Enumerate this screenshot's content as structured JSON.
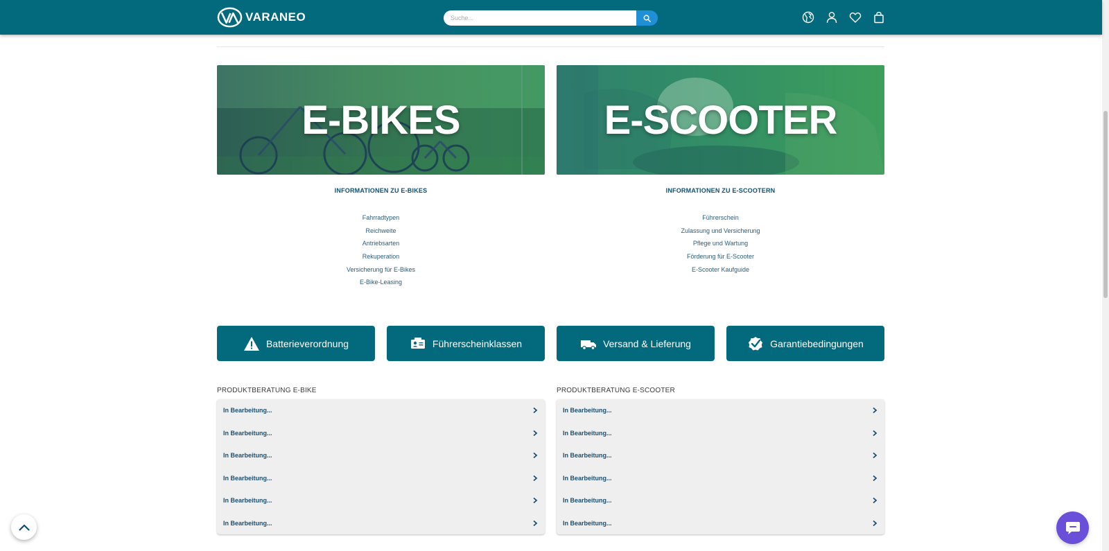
{
  "header": {
    "brand": "VARANEO",
    "search": {
      "placeholder": "Suche..."
    },
    "icons": [
      "globe-icon",
      "user-icon",
      "heart-icon",
      "shopping-bag-icon"
    ],
    "background_color": "#036a7e"
  },
  "banners": [
    {
      "title": "E-BIKES"
    },
    {
      "title": "E-SCOOTER"
    }
  ],
  "info": {
    "ebikes": {
      "heading": "INFORMATIONEN ZU E-BIKES",
      "links": [
        "Fahrradtypen",
        "Reichweite",
        "Antriebsarten",
        "Rekuperation",
        "Versicherung für E-Bikes",
        "E-Bike-Leasing"
      ]
    },
    "escooter": {
      "heading": "INFORMATIONEN ZU E-SCOOTERN",
      "links": [
        "Führerschein",
        "Zulassung und Versicherung",
        "Pflege und Wartung",
        "Förderung für E-Scooter",
        "E-Scooter Kaufguide"
      ]
    }
  },
  "buttons": [
    {
      "label": "Batterieverordnung",
      "icon": "warning-icon"
    },
    {
      "label": "Führerscheinklassen",
      "icon": "id-card-icon"
    },
    {
      "label": "Versand & Lieferung",
      "icon": "truck-icon"
    },
    {
      "label": "Garantiebedingungen",
      "icon": "check-badge-icon"
    }
  ],
  "produktberatung": {
    "ebike": {
      "title": "PRODUKTBERATUNG E-BIKE",
      "items": [
        "In Bearbeitung...",
        "In Bearbeitung...",
        "In Bearbeitung...",
        "In Bearbeitung...",
        "In Bearbeitung...",
        "In Bearbeitung..."
      ]
    },
    "escooter": {
      "title": "PRODUKTBERATUNG E-SCOOTER",
      "items": [
        "In Bearbeitung...",
        "In Bearbeitung...",
        "In Bearbeitung...",
        "In Bearbeitung...",
        "In Bearbeitung...",
        "In Bearbeitung..."
      ]
    }
  },
  "floating": {
    "back_to_top_icon": "chevron-up-icon",
    "chat_icon": "chat-bubble-icon",
    "chat_color": "#6a4fd8"
  }
}
